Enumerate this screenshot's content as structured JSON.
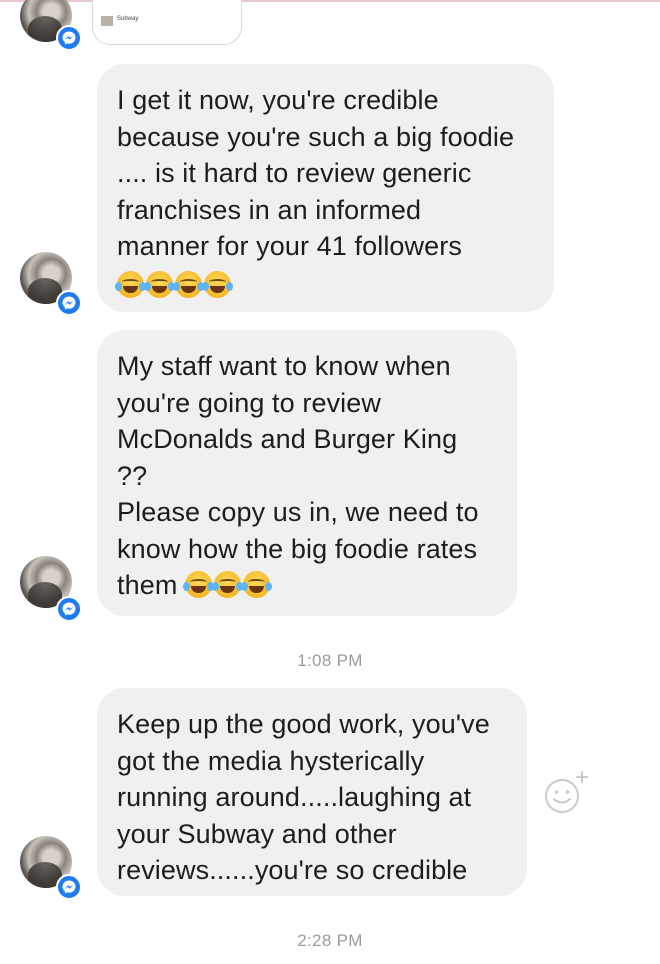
{
  "link_preview": {
    "top_text": "",
    "title": "Subway",
    "subtitle": ""
  },
  "messages": [
    {
      "lines": [
        "I get it now, you're credible",
        "because you're such a big foodie",
        ".... is it hard to review generic",
        "franchises in an informed",
        "manner for your 41 followers"
      ],
      "emoji_count": 4
    },
    {
      "lines": [
        "My staff want to know when",
        "you're going to review",
        "McDonalds and Burger King",
        "??",
        "Please copy us in, we need to",
        "know how the big foodie rates",
        "them"
      ],
      "emoji_count": 3
    },
    {
      "lines": [
        "Keep up the good work, you've",
        "got the media hysterically",
        "running around.....laughing at",
        "your Subway and other",
        "reviews......you're so credible"
      ]
    }
  ],
  "timestamps": [
    "1:08 PM",
    "2:28 PM"
  ],
  "icons": {
    "avatar": "profile-photo",
    "badge": "messenger-badge-icon",
    "reaction": "add-reaction-smiley-icon",
    "emoji": "face-with-tears-of-joy"
  },
  "colors": {
    "bubble": "#f1f0f0",
    "badge": "#1e7bf2",
    "timestamp": "#9b9b9b"
  }
}
